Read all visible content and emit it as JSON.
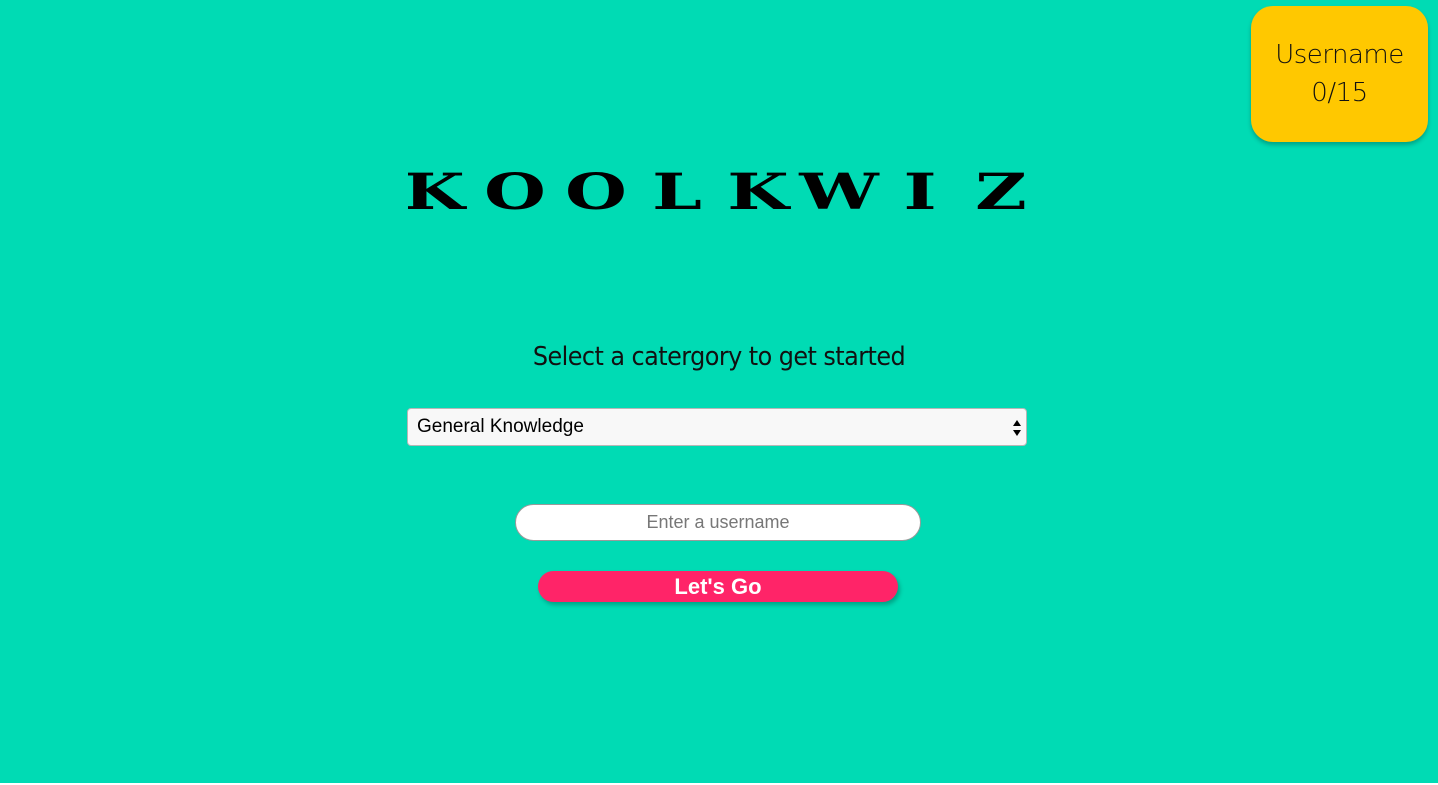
{
  "score_card": {
    "label": "Username",
    "score": "0/15"
  },
  "logo": {
    "text": "KOOLKWIZ",
    "letters": [
      "K",
      "O",
      "O",
      "L",
      "K",
      "W",
      "I",
      "Z"
    ]
  },
  "subtitle": "Select a catergory to get started",
  "category_select": {
    "selected": "General Knowledge"
  },
  "username_input": {
    "value": "",
    "placeholder": "Enter a username"
  },
  "go_button": {
    "label": "Let's Go"
  },
  "colors": {
    "background": "#00DBB4",
    "score_card": "#FFC800",
    "button": "#FF2468"
  }
}
